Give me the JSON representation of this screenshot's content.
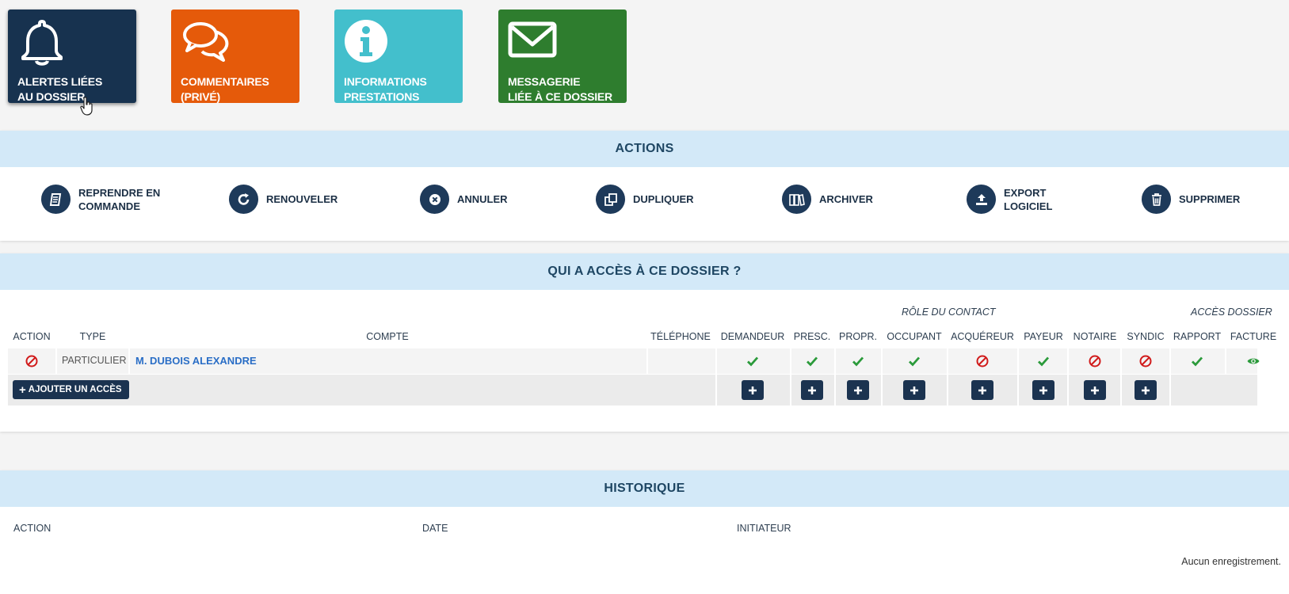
{
  "tiles": [
    {
      "label": "ALERTES LIÉES\nAU DOSSIER",
      "color": "#17324f",
      "icon": "bell-icon"
    },
    {
      "label": "COMMENTAIRES\n(PRIVÉ)",
      "color": "#e55a0a",
      "icon": "comments-icon"
    },
    {
      "label": "INFORMATIONS\nPRESTATIONS",
      "color": "#43bfcc",
      "icon": "info-icon"
    },
    {
      "label": "MESSAGERIE\nLIÉE À CE DOSSIER",
      "color": "#2e7d2e",
      "icon": "envelope-icon"
    }
  ],
  "actions": {
    "title": "ACTIONS",
    "items": [
      {
        "label": "REPRENDRE EN\nCOMMANDE",
        "icon": "order-icon"
      },
      {
        "label": "RENOUVELER",
        "icon": "refresh-icon"
      },
      {
        "label": "ANNULER",
        "icon": "cancel-icon"
      },
      {
        "label": "DUPLIQUER",
        "icon": "copy-icon"
      },
      {
        "label": "ARCHIVER",
        "icon": "archive-icon"
      },
      {
        "label": "EXPORT\nLOGICIEL",
        "icon": "upload-icon"
      },
      {
        "label": "SUPPRIMER",
        "icon": "trash-icon"
      }
    ]
  },
  "access": {
    "title": "QUI A ACCÈS À CE DOSSIER ?",
    "group_role": "RÔLE DU CONTACT",
    "group_access": "ACCÈS DOSSIER",
    "headers": {
      "action": "ACTION",
      "type": "TYPE",
      "compte": "COMPTE",
      "telephone": "TÉLÉPHONE",
      "demandeur": "DEMANDEUR",
      "presc": "PRESC.",
      "propr": "PROPR.",
      "occupant": "OCCUPANT",
      "acquereur": "ACQUÉREUR",
      "payeur": "PAYEUR",
      "notaire": "NOTAIRE",
      "syndic": "SYNDIC",
      "rapport": "RAPPORT",
      "facture": "FACTURE"
    },
    "row": {
      "action_icon": "forbidden-icon",
      "type": "PARTICULIER",
      "compte": "M. DUBOIS ALEXANDRE",
      "telephone": "",
      "demandeur": "check",
      "presc": "check",
      "propr": "check",
      "occupant": "check",
      "acquereur": "forbidden",
      "payeur": "check",
      "notaire": "forbidden",
      "syndic": "forbidden",
      "rapport": "check",
      "facture": "eye"
    },
    "add_button": "AJOUTER UN ACCÈS"
  },
  "history": {
    "title": "HISTORIQUE",
    "headers": {
      "action": "ACTION",
      "date": "DATE",
      "initiateur": "INITIATEUR"
    },
    "empty": "Aucun enregistrement."
  }
}
